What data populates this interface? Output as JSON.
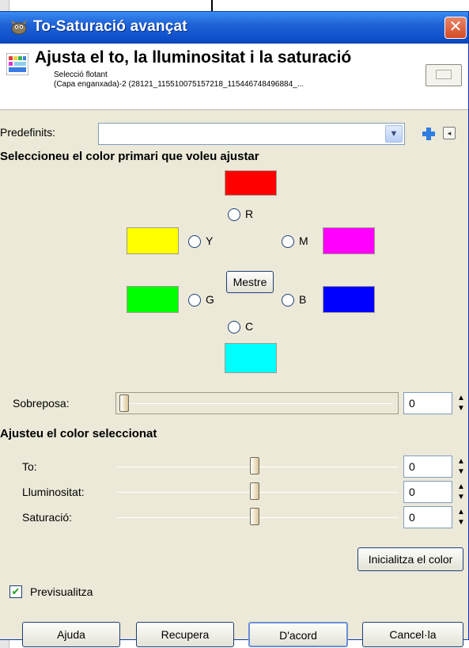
{
  "window": {
    "title": "To-Saturació avançat",
    "close_glyph": "✕"
  },
  "header": {
    "title": "Ajusta el to, la lluminositat i la saturació",
    "subtitle": "Selecció flotant",
    "layer": "(Capa enganxada)-2 (28121_115510075157218_115446748496884_..."
  },
  "presets": {
    "label": "Predefinits:",
    "value": "",
    "add_icon": "plus-icon",
    "menu_icon": "menu-icon"
  },
  "primary": {
    "heading": "Seleccioneu el color primari que voleu ajustar",
    "colors": {
      "R": "#ff0000",
      "Y": "#ffff00",
      "M": "#ff00ff",
      "G": "#00ff00",
      "B": "#0000ff",
      "C": "#00ffff"
    },
    "radios": {
      "R": "R",
      "Y": "Y",
      "M": "M",
      "G": "G",
      "B": "B",
      "C": "C"
    },
    "master_label": "Mestre"
  },
  "overlap": {
    "label": "Sobreposa:",
    "value": "0"
  },
  "adjust": {
    "heading": "Ajusteu el color seleccionat",
    "hue": {
      "label": "To:",
      "value": "0"
    },
    "lightness": {
      "label": "Lluminositat:",
      "value": "0"
    },
    "saturation": {
      "label": "Saturació:",
      "value": "0"
    },
    "reset_label": "Inicialitza el color"
  },
  "preview": {
    "label": "Previsualitza",
    "checked": "✔"
  },
  "buttons": {
    "help": "Ajuda",
    "reset": "Recupera",
    "ok": "D'acord",
    "cancel": "Cancel·la"
  }
}
